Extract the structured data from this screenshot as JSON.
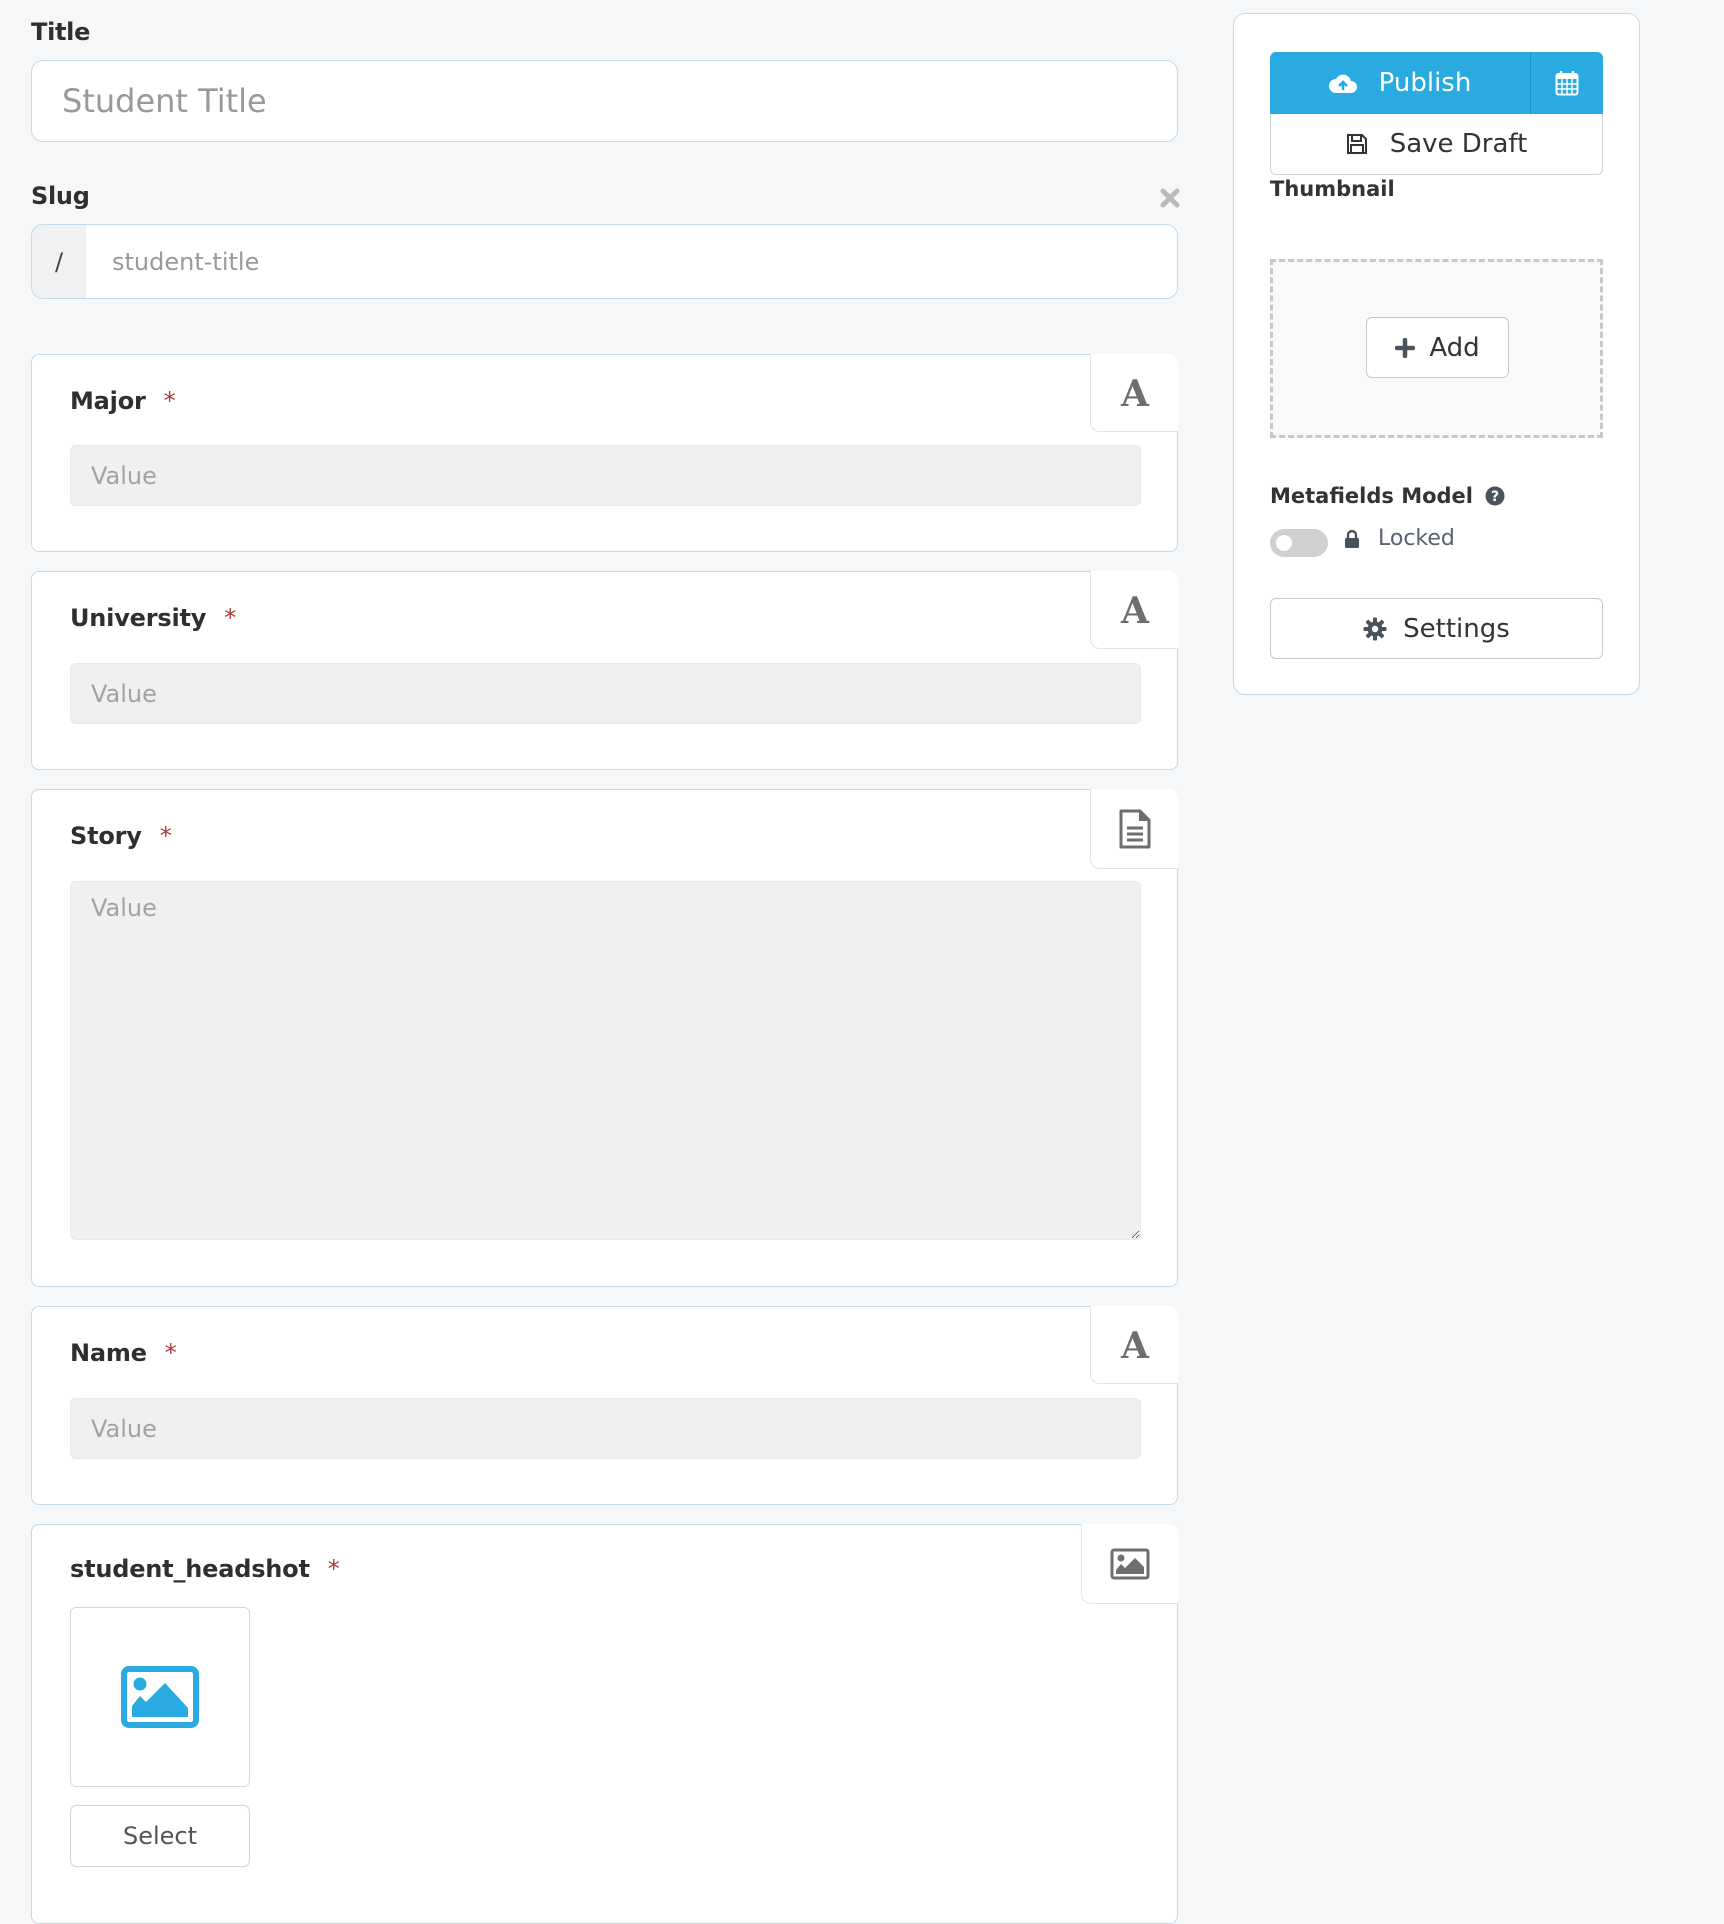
{
  "title_field": {
    "label": "Title",
    "placeholder": "Student Title",
    "value": ""
  },
  "slug_field": {
    "label": "Slug",
    "prefix": "/",
    "placeholder": "student-title",
    "value": "",
    "clear_icon": "close-icon"
  },
  "metafields": [
    {
      "label": "Major",
      "required_mark": "*",
      "type_icon": "text-type-icon",
      "placeholder": "Value",
      "kind": "text"
    },
    {
      "label": "University",
      "required_mark": "*",
      "type_icon": "text-type-icon",
      "placeholder": "Value",
      "kind": "text"
    },
    {
      "label": "Story",
      "required_mark": "*",
      "type_icon": "document-icon",
      "placeholder": "Value",
      "kind": "textarea"
    },
    {
      "label": "Name",
      "required_mark": "*",
      "type_icon": "text-type-icon",
      "placeholder": "Value",
      "kind": "text"
    },
    {
      "label": "student_headshot",
      "required_mark": "*",
      "type_icon": "image-icon",
      "kind": "image",
      "select_label": "Select"
    }
  ],
  "sidebar": {
    "publish_label": "Publish",
    "publish_icon": "cloud-upload-icon",
    "schedule_icon": "calendar-icon",
    "save_draft_label": "Save Draft",
    "save_draft_icon": "floppy-disk-icon",
    "thumbnail_label": "Thumbnail",
    "add_label": "Add",
    "add_icon": "plus-icon",
    "metafields_model_label": "Metafields Model",
    "help_icon": "question-circle-icon",
    "toggle_on": false,
    "lock_icon": "lock-icon",
    "locked_label": "Locked",
    "settings_label": "Settings",
    "settings_icon": "gear-icon"
  },
  "colors": {
    "accent": "#29abe2",
    "required": "#b03a3a",
    "background": "#f5f7f9",
    "border": "#c3dae8"
  }
}
